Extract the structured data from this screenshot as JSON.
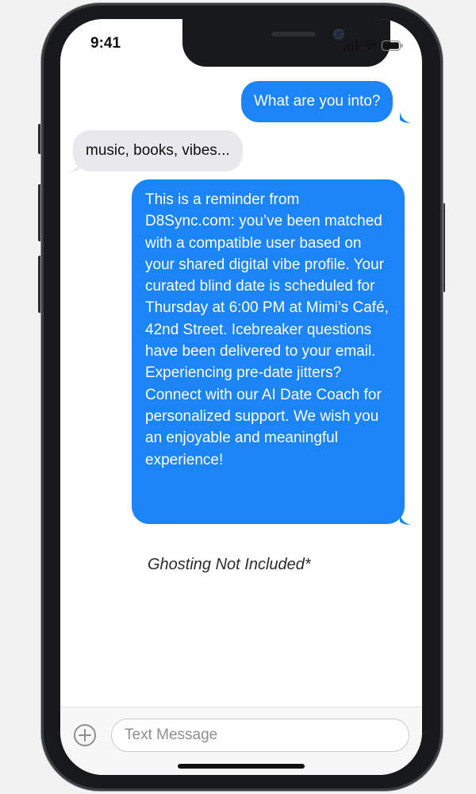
{
  "status_bar": {
    "time": "9:41"
  },
  "conversation": {
    "messages": [
      {
        "direction": "sent",
        "text": "What are you into?"
      },
      {
        "direction": "received",
        "text": "music, books, vibes..."
      },
      {
        "direction": "sent",
        "text": "This is a reminder from D8Sync.com: you’ve been matched with a compatible user based on your shared digital vibe profile. Your curated blind date is scheduled for Thursday at 6:00 PM at Mimi’s Café, 42nd Street. Icebreaker questions have been delivered to your email. Experiencing pre-date jitters? Connect with our AI Date Coach for personalized support. We wish you an enjoyable and meaningful experience!"
      }
    ],
    "footnote": "Ghosting Not Included*"
  },
  "compose": {
    "placeholder": "Text Message",
    "value": "",
    "add_icon": "plus-circle-icon"
  },
  "icons": {
    "signal": "cellular-signal-icon",
    "wifi": "wifi-icon",
    "battery": "battery-icon"
  },
  "colors": {
    "sent_bubble": "#1b84f7",
    "received_bubble": "#e9e9eb",
    "frame": "#17191b"
  }
}
